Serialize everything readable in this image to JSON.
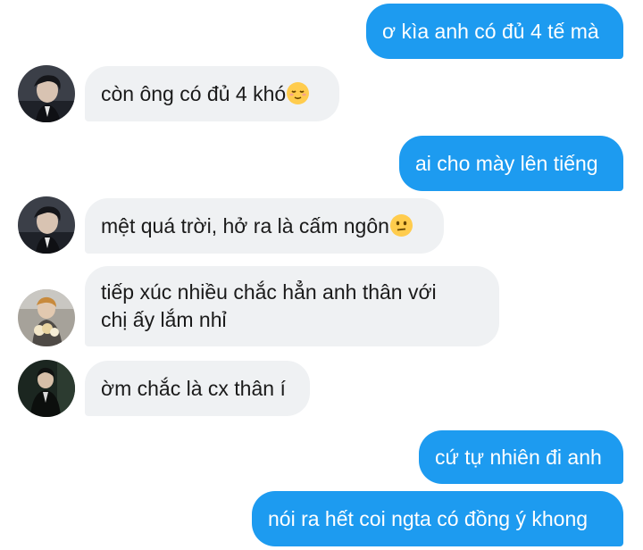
{
  "messages": [
    {
      "text": "ơ kìa anh có đủ 4 tế mà"
    },
    {
      "text": "còn ông có đủ 4 khó",
      "emoji": "relieved-face-icon"
    },
    {
      "text": "ai cho mày lên tiếng"
    },
    {
      "text": "mệt quá trời, hở ra là cấm ngôn",
      "emoji": "confused-face-icon"
    },
    {
      "line1": "tiếp xúc nhiều chắc hẳn anh thân với",
      "line2": "chị ấy lắm nhỉ"
    },
    {
      "text": "ờm chắc là cx thân í"
    },
    {
      "text": "cứ tự nhiên đi anh"
    },
    {
      "text": "nói ra hết coi ngta có đồng ý khong"
    }
  ],
  "colors": {
    "outgoing": "#1d9bf0",
    "incoming": "#eff1f3",
    "emoji": "#ffcc4d"
  }
}
